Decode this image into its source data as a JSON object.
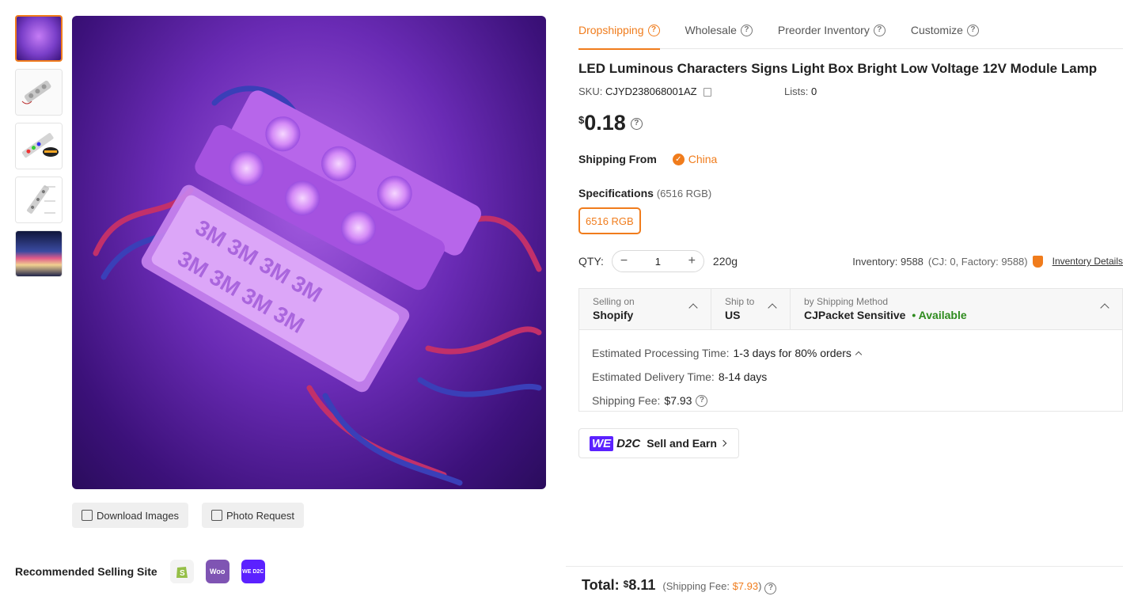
{
  "gallery": {
    "thumbnails": [
      {
        "name": "purple-led-modules",
        "color": "#7a3fc9"
      },
      {
        "name": "led-module-white",
        "color": "#e8e8e8"
      },
      {
        "name": "led-strip-rainbow",
        "color": "#f2f2f2"
      },
      {
        "name": "led-module-diagram",
        "color": "#f4f4f4"
      },
      {
        "name": "led-sign-night",
        "color": "#3a4aa0"
      }
    ],
    "download_label": "Download Images",
    "photo_request_label": "Photo Request"
  },
  "recommended": {
    "title": "Recommended Selling Site",
    "sites": [
      {
        "name": "shopify",
        "label": "S",
        "color": "#f3f3f3"
      },
      {
        "name": "woocommerce",
        "label": "Woo",
        "color": "#7f54b3"
      },
      {
        "name": "wed2c",
        "label": "WE D2C",
        "color": "#5b21ff"
      }
    ]
  },
  "tabs": [
    {
      "label": "Dropshipping",
      "active": true
    },
    {
      "label": "Wholesale",
      "active": false
    },
    {
      "label": "Preorder Inventory",
      "active": false
    },
    {
      "label": "Customize",
      "active": false
    }
  ],
  "product": {
    "title": "LED Luminous Characters Signs Light Box Bright Low Voltage 12V Module Lamp",
    "sku_label": "SKU:",
    "sku": "CJYD238068001AZ",
    "lists_label": "Lists:",
    "lists": "0",
    "currency": "$",
    "price": "0.18"
  },
  "shipping_from": {
    "label": "Shipping From",
    "country": "China"
  },
  "specifications": {
    "label": "Specifications",
    "count": "(6516 RGB)",
    "selected": "6516 RGB"
  },
  "quantity": {
    "label": "QTY:",
    "value": "1",
    "weight": "220g",
    "inventory_label": "Inventory:",
    "inventory": "9588",
    "inventory_breakdown": "(CJ: 0, Factory: 9588)",
    "inventory_details": "Inventory Details"
  },
  "shipping": {
    "selling_on_label": "Selling on",
    "selling_on": "Shopify",
    "ship_to_label": "Ship to",
    "ship_to": "US",
    "method_label": "by Shipping Method",
    "method": "CJPacket Sensitive",
    "availability": "• Available",
    "processing_label": "Estimated Processing Time:",
    "processing": "1-3 days for 80% orders",
    "delivery_label": "Estimated Delivery Time:",
    "delivery": "8-14 days",
    "fee_label": "Shipping Fee:",
    "fee": "$7.93"
  },
  "wed2c": {
    "we": "WE",
    "d2c": "D2C",
    "label": "Sell and Earn"
  },
  "total": {
    "label": "Total:",
    "currency": "$",
    "value": "8.11",
    "fee_prefix": "(Shipping Fee:",
    "fee": "$7.93",
    "fee_suffix": ")"
  },
  "colors": {
    "accent": "#f07c1c",
    "available": "#2e8b1e",
    "wed2c": "#5b21ff"
  }
}
